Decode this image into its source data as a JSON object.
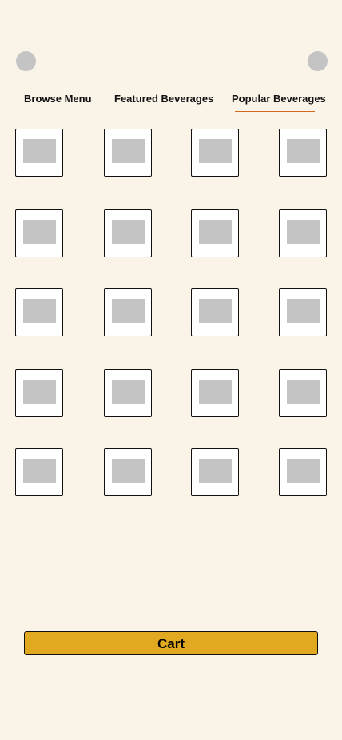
{
  "header": {
    "left_button_icon": "circle-icon",
    "right_button_icon": "circle-icon"
  },
  "tabs": [
    {
      "label": "Browse Menu",
      "active": false
    },
    {
      "label": "Featured Beverages",
      "active": false
    },
    {
      "label": "Popular Beverages",
      "active": true
    }
  ],
  "colors": {
    "background": "#faf3e8",
    "accent_underline": "#d2691e",
    "cart_button": "#e1a920",
    "placeholder": "#c4c4c4"
  },
  "grid": {
    "rows": 5,
    "columns": 4,
    "item_icon": "image-placeholder-icon"
  },
  "cart": {
    "label": "Cart"
  }
}
